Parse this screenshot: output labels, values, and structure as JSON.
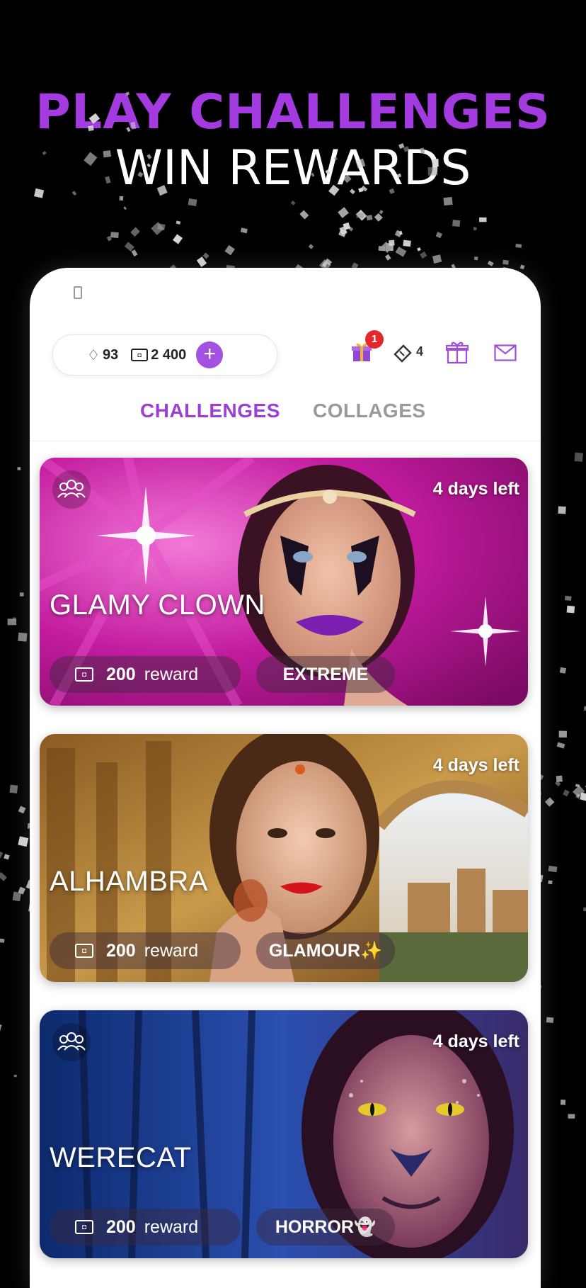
{
  "headline": {
    "line1": "PLAY CHALLENGES",
    "line2": "WIN REWARDS"
  },
  "colors": {
    "accent": "#9b3fd6",
    "badge": "#e2282b",
    "inactive_tab": "#9a9a9a"
  },
  "wallet": {
    "gems": "93",
    "coins": "2 400",
    "add_label": "+"
  },
  "header_icons": {
    "gift_badge": "1",
    "tickets": "4"
  },
  "tabs": [
    {
      "label": "CHALLENGES",
      "active": true
    },
    {
      "label": "COLLAGES",
      "active": false
    }
  ],
  "challenges": [
    {
      "title": "GLAMY CLOWN",
      "days_left": "4 days left",
      "reward_amount": "200",
      "reward_label": "reward",
      "category": "EXTREME",
      "group_icon": true
    },
    {
      "title": "ALHAMBRA",
      "days_left": "4 days left",
      "reward_amount": "200",
      "reward_label": "reward",
      "category": "GLAMOUR✨",
      "group_icon": false
    },
    {
      "title": "WERECAT",
      "days_left": "4 days left",
      "reward_amount": "200",
      "reward_label": "reward",
      "category": "HORROR👻",
      "group_icon": true
    }
  ]
}
